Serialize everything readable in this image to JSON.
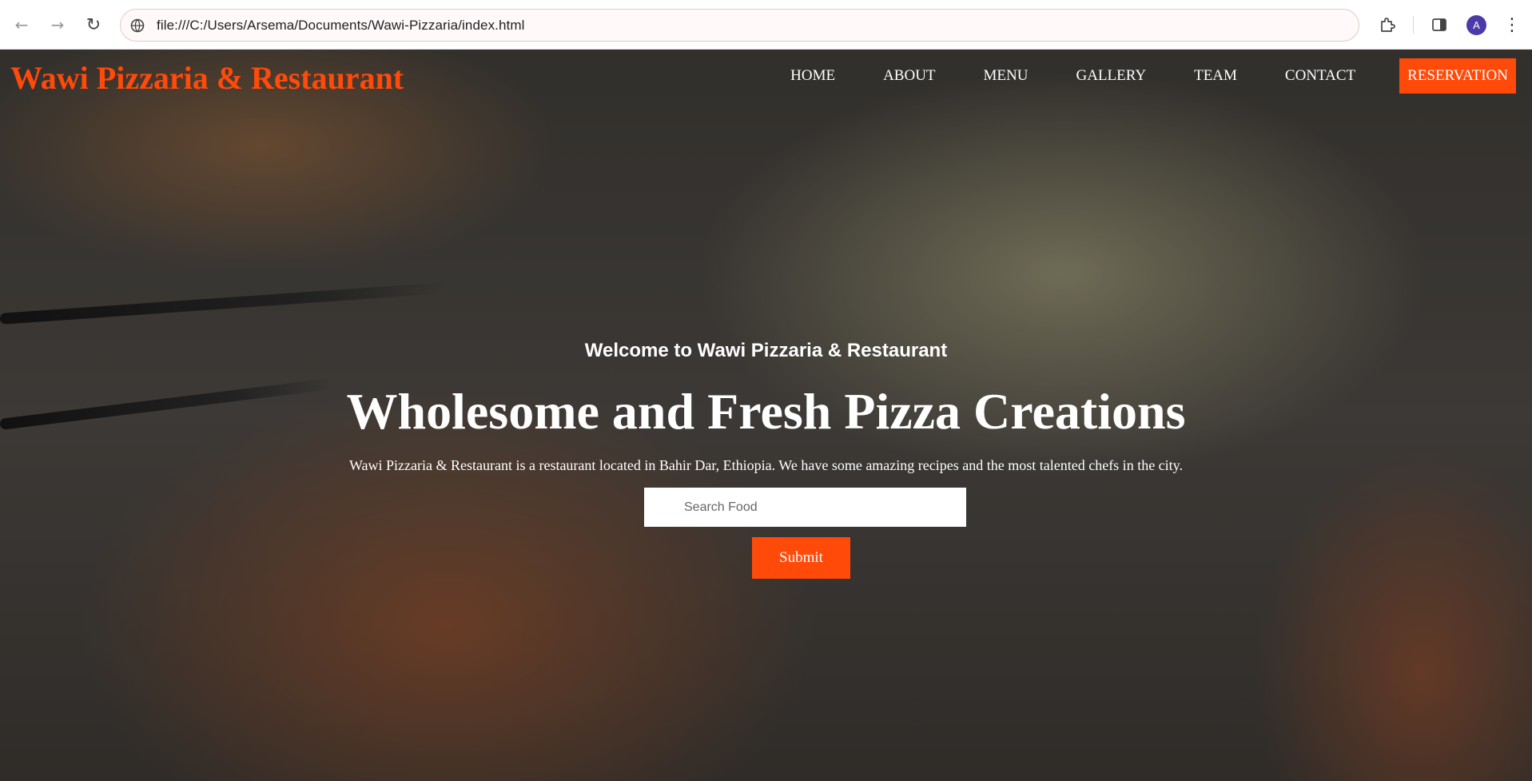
{
  "browser": {
    "url": "file:///C:/Users/Arsema/Documents/Wawi-Pizzaria/index.html",
    "profile_initial": "A"
  },
  "site": {
    "brand": "Wawi Pizzaria & Restaurant",
    "brand_color": "#ff4a0a",
    "nav": [
      {
        "label": "HOME"
      },
      {
        "label": "ABOUT"
      },
      {
        "label": "MENU"
      },
      {
        "label": "GALLERY"
      },
      {
        "label": "TEAM"
      },
      {
        "label": "CONTACT"
      }
    ],
    "reservation_label": "RESERVATION"
  },
  "hero": {
    "welcome": "Welcome to Wawi Pizzaria & Restaurant",
    "title": "Wholesome and Fresh Pizza Creations",
    "description": "Wawi Pizzaria & Restaurant is a restaurant located in Bahir Dar, Ethiopia. We have some amazing recipes and the most talented chefs in the city.",
    "search_placeholder": "Search Food",
    "submit_label": "Submit"
  }
}
